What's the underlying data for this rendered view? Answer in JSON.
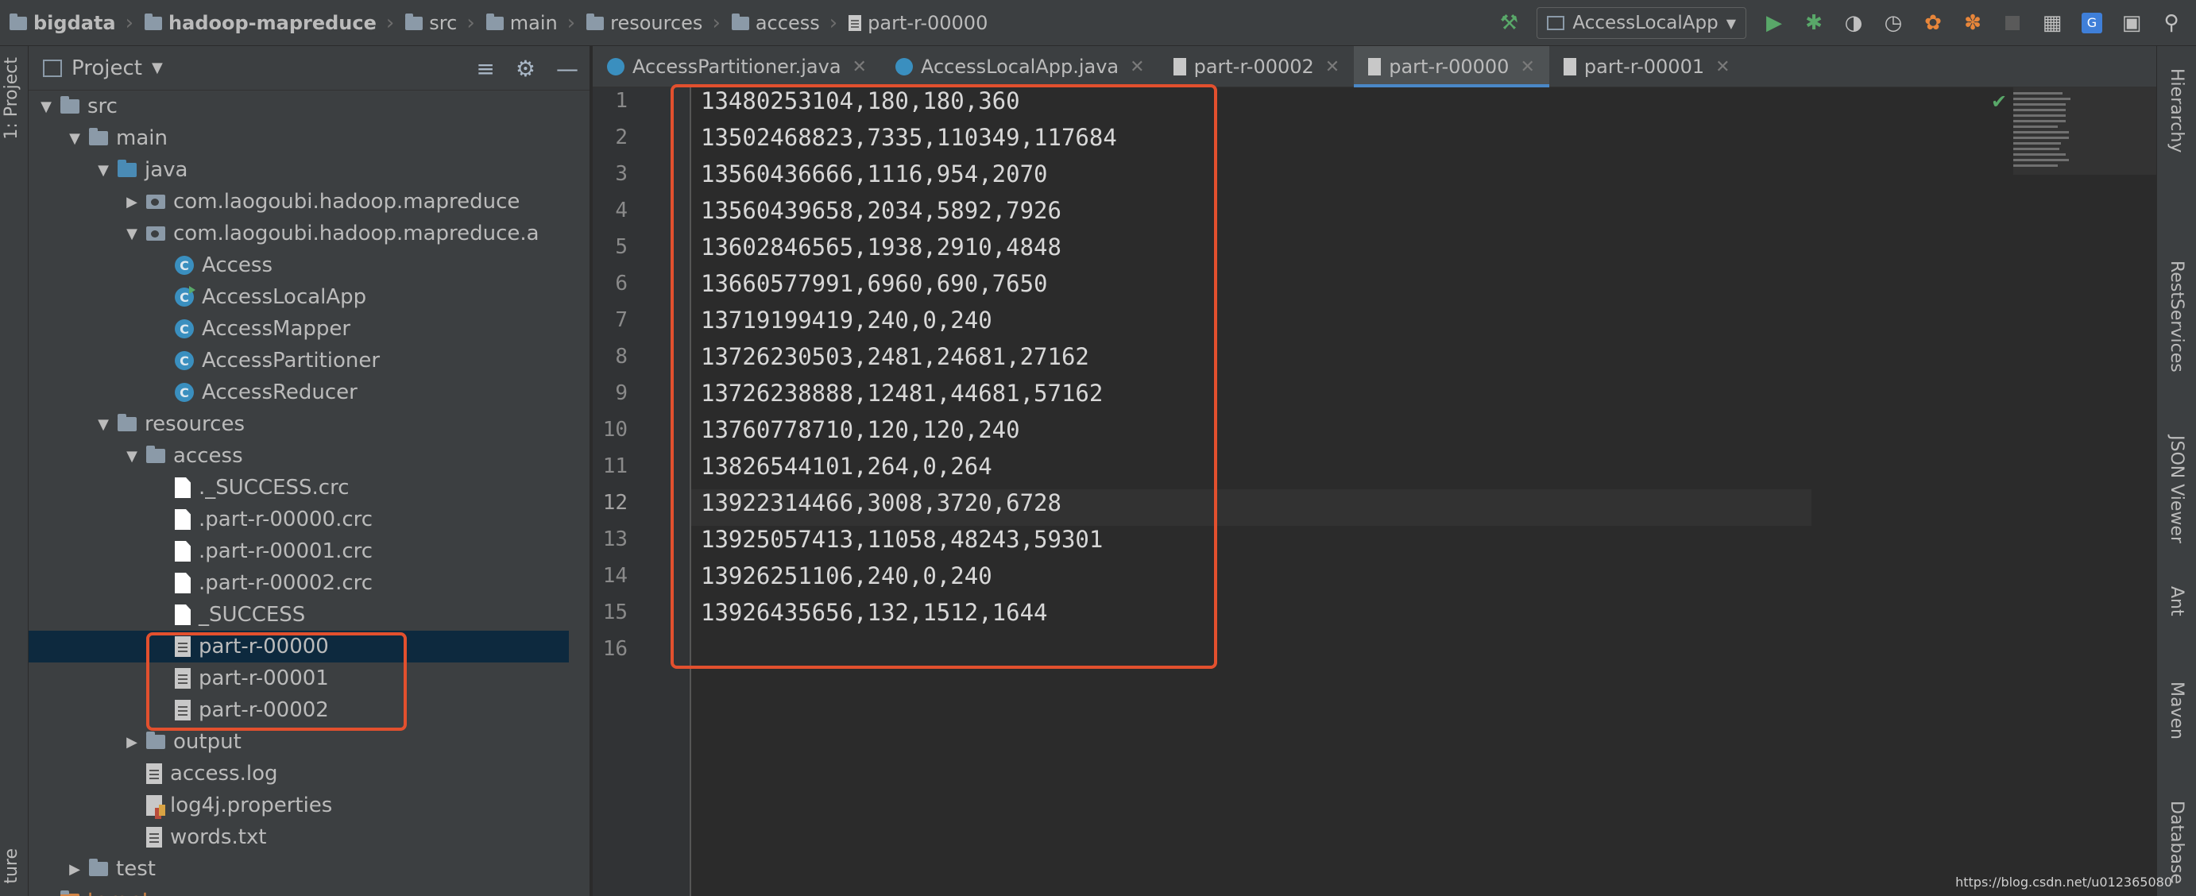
{
  "breadcrumb": [
    "bigdata",
    "hadoop-mapreduce",
    "src",
    "main",
    "resources",
    "access",
    "part-r-00000"
  ],
  "toolbar": {
    "run_config": "AccessLocalApp",
    "icons": [
      "build-hammer-icon",
      "run-icon",
      "debug-icon",
      "coverage-icon",
      "profile-icon",
      "attach-icon",
      "debug-bug-icon",
      "stop-icon",
      "project-structure-icon",
      "translate-icon",
      "terminal-icon",
      "search-icon"
    ]
  },
  "left_strip": {
    "project_tab": "1: Project",
    "structure_tab": "ture"
  },
  "project_panel": {
    "title": "Project",
    "tree": [
      {
        "label": "src",
        "indent": 0,
        "arrow": "▼",
        "icon": "folder"
      },
      {
        "label": "main",
        "indent": 1,
        "arrow": "▼",
        "icon": "folder"
      },
      {
        "label": "java",
        "indent": 2,
        "arrow": "▼",
        "icon": "folder-java"
      },
      {
        "label": "com.laogoubi.hadoop.mapreduce",
        "indent": 3,
        "arrow": "▶",
        "icon": "package"
      },
      {
        "label": "com.laogoubi.hadoop.mapreduce.a",
        "indent": 3,
        "arrow": "▼",
        "icon": "package"
      },
      {
        "label": "Access",
        "indent": 4,
        "arrow": "",
        "icon": "class"
      },
      {
        "label": "AccessLocalApp",
        "indent": 4,
        "arrow": "",
        "icon": "class-run"
      },
      {
        "label": "AccessMapper",
        "indent": 4,
        "arrow": "",
        "icon": "class"
      },
      {
        "label": "AccessPartitioner",
        "indent": 4,
        "arrow": "",
        "icon": "class"
      },
      {
        "label": "AccessReducer",
        "indent": 4,
        "arrow": "",
        "icon": "class"
      },
      {
        "label": "resources",
        "indent": 2,
        "arrow": "▼",
        "icon": "folder-res"
      },
      {
        "label": "access",
        "indent": 3,
        "arrow": "▼",
        "icon": "folder"
      },
      {
        "label": "._SUCCESS.crc",
        "indent": 4,
        "arrow": "",
        "icon": "file"
      },
      {
        "label": ".part-r-00000.crc",
        "indent": 4,
        "arrow": "",
        "icon": "file"
      },
      {
        "label": ".part-r-00001.crc",
        "indent": 4,
        "arrow": "",
        "icon": "file"
      },
      {
        "label": ".part-r-00002.crc",
        "indent": 4,
        "arrow": "",
        "icon": "file"
      },
      {
        "label": "_SUCCESS",
        "indent": 4,
        "arrow": "",
        "icon": "file"
      },
      {
        "label": "part-r-00000",
        "indent": 4,
        "arrow": "",
        "icon": "text",
        "selected": true
      },
      {
        "label": "part-r-00001",
        "indent": 4,
        "arrow": "",
        "icon": "text"
      },
      {
        "label": "part-r-00002",
        "indent": 4,
        "arrow": "",
        "icon": "text"
      },
      {
        "label": "output",
        "indent": 3,
        "arrow": "▶",
        "icon": "folder"
      },
      {
        "label": "access.log",
        "indent": 3,
        "arrow": "",
        "icon": "text"
      },
      {
        "label": "log4j.properties",
        "indent": 3,
        "arrow": "",
        "icon": "props"
      },
      {
        "label": "words.txt",
        "indent": 3,
        "arrow": "",
        "icon": "text"
      },
      {
        "label": "test",
        "indent": 1,
        "arrow": "▶",
        "icon": "folder"
      },
      {
        "label": "target",
        "indent": 0,
        "arrow": "▶",
        "icon": "folder-target"
      }
    ]
  },
  "tabs": [
    {
      "label": "AccessPartitioner.java",
      "icon": "class",
      "active": false
    },
    {
      "label": "AccessLocalApp.java",
      "icon": "class-run",
      "active": false
    },
    {
      "label": "part-r-00002",
      "icon": "text",
      "active": false
    },
    {
      "label": "part-r-00000",
      "icon": "text",
      "active": true
    },
    {
      "label": "part-r-00001",
      "icon": "text",
      "active": false
    }
  ],
  "editor": {
    "current_line": 12,
    "lines": [
      "13480253104,180,180,360",
      "13502468823,7335,110349,117684",
      "13560436666,1116,954,2070",
      "13560439658,2034,5892,7926",
      "13602846565,1938,2910,4848",
      "13660577991,6960,690,7650",
      "13719199419,240,0,240",
      "13726230503,2481,24681,27162",
      "13726238888,12481,44681,57162",
      "13760778710,120,120,240",
      "13826544101,264,0,264",
      "13922314466,3008,3720,6728",
      "13925057413,11058,48243,59301",
      "13926251106,240,0,240",
      "13926435656,132,1512,1644",
      ""
    ]
  },
  "right_strip": [
    "Hierarchy",
    "RestServices",
    "JSON Viewer",
    "Ant",
    "Maven",
    "Database"
  ],
  "watermark": "https://blog.csdn.net/u012365080",
  "colors": {
    "highlight": "#e2502e",
    "accent": "#4a88c7"
  }
}
